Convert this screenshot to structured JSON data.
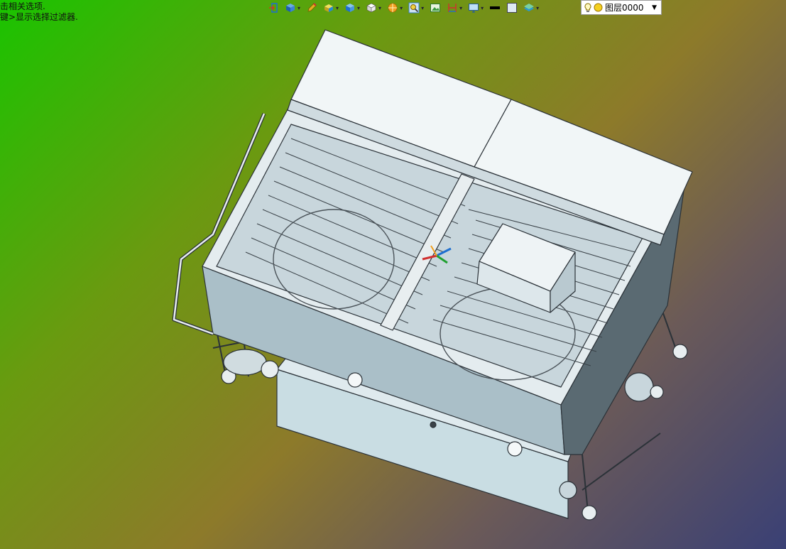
{
  "hint": {
    "line1": "击相关选项.",
    "line2": "键>显示选择过滤器."
  },
  "toolbar": {
    "icons": [
      "exit-sketch-icon",
      "view-orientation-icon",
      "pencil-icon",
      "box-yellow-icon",
      "cube-blue-icon",
      "cube-white-icon",
      "sun-orange-icon",
      "zoom-magnifier-icon",
      "image-frame-icon",
      "dimension-icon",
      "monitor-icon",
      "black-line-icon",
      "blank-square-icon",
      "layers-icon"
    ],
    "layer_label": "图层0000"
  },
  "colors": {
    "accent_blue": "#1e6fd0",
    "model_face": "#e8eef0",
    "model_edge": "#2b3238"
  }
}
